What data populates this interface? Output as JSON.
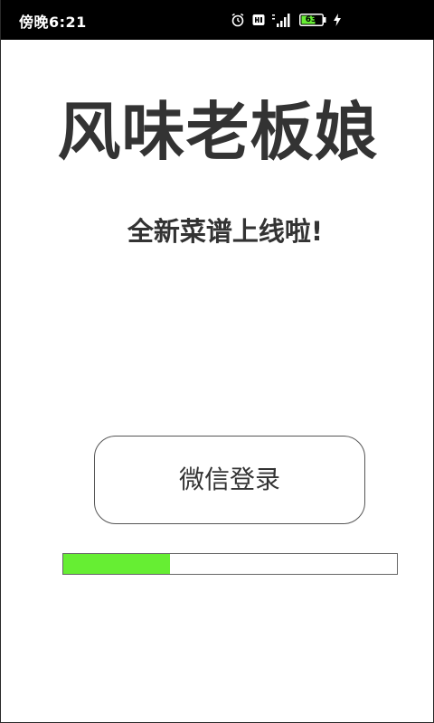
{
  "status_bar": {
    "time": "傍晚6:21",
    "icons": [
      "alarm-icon",
      "hd-icon",
      "signal-icon",
      "battery-icon",
      "charging-icon"
    ],
    "battery_level": "63"
  },
  "main": {
    "title": "风味老板娘",
    "subtitle": "全新菜谱上线啦!",
    "login_button_label": "微信登录",
    "progress": 0.32
  },
  "colors": {
    "progress_fill": "#66ee33",
    "text": "#333333",
    "status_bar_bg": "#000000"
  }
}
